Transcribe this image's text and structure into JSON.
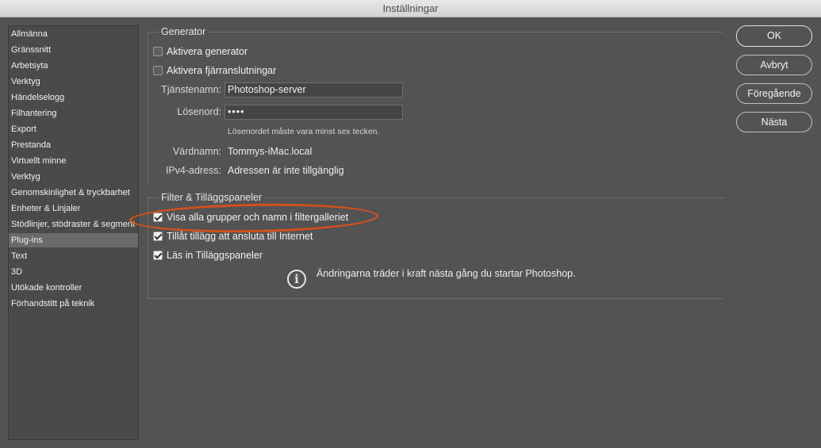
{
  "window": {
    "title": "Inställningar"
  },
  "sidebar": {
    "items": [
      {
        "label": "Allmänna"
      },
      {
        "label": "Gränssnitt"
      },
      {
        "label": "Arbetsyta"
      },
      {
        "label": "Verktyg"
      },
      {
        "label": "Händelselogg"
      },
      {
        "label": "Filhantering"
      },
      {
        "label": "Export"
      },
      {
        "label": "Prestanda"
      },
      {
        "label": "Virtuellt minne"
      },
      {
        "label": "Verktyg"
      },
      {
        "label": "Genomskinlighet & tryckbarhet"
      },
      {
        "label": "Enheter & Linjaler"
      },
      {
        "label": "Stödlinjer, stödraster & segment"
      },
      {
        "label": "Plug-ins",
        "selected": true
      },
      {
        "label": "Text"
      },
      {
        "label": "3D"
      },
      {
        "label": "Utökade kontroller"
      },
      {
        "label": "Förhandstitt på teknik"
      }
    ]
  },
  "generator": {
    "title": "Generator",
    "enable_generator": {
      "label": "Aktivera generator",
      "checked": false
    },
    "enable_remote": {
      "label": "Aktivera fjärranslutningar",
      "checked": false
    },
    "service_name": {
      "label": "Tjänstenamn:",
      "value": "Photoshop-server"
    },
    "password": {
      "label": "Lösenord:",
      "value": "••••"
    },
    "password_hint": "Lösenordet måste vara minst sex tecken.",
    "host_name": {
      "label": "Värdnamn:",
      "value": "Tommys-iMac.local"
    },
    "ipv4": {
      "label": "IPv4-adress:",
      "value": "Adressen är inte tillgänglig"
    }
  },
  "filters": {
    "title": "Filter & Tilläggspaneler",
    "show_all_groups": {
      "label": "Visa alla grupper och namn i filtergalleriet",
      "checked": true
    },
    "allow_internet": {
      "label": "Tillåt tillägg att ansluta till Internet",
      "checked": true
    },
    "load_panels": {
      "label": "Läs in Tilläggspaneler",
      "checked": true
    },
    "notice": "Ändringarna träder i kraft nästa gång du startar Photoshop."
  },
  "buttons": {
    "ok": "OK",
    "cancel": "Avbryt",
    "previous": "Föregående",
    "next": "Nästa"
  },
  "colors": {
    "background": "#535353",
    "highlight": "#d2501d"
  }
}
